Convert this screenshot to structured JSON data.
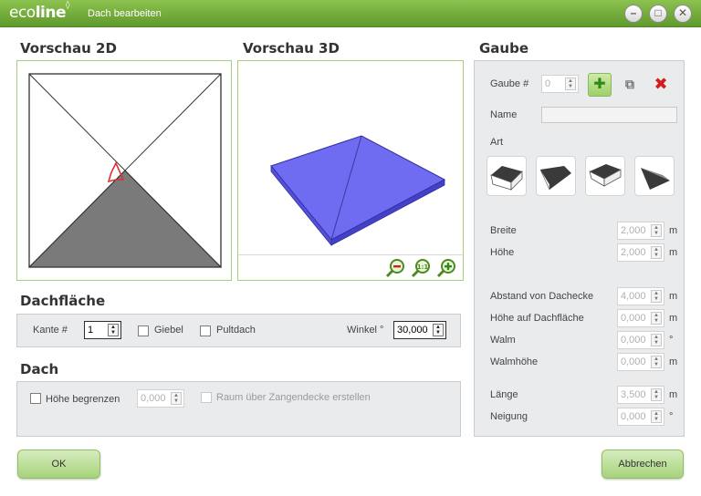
{
  "window": {
    "logo_text": "eco",
    "logo_bold": "line",
    "title": "Dach bearbeiten",
    "buttons": [
      "–",
      "□",
      "✕"
    ]
  },
  "preview2d": {
    "title": "Vorschau 2D"
  },
  "preview3d": {
    "title": "Vorschau 3D",
    "zoom_icons": [
      "zoom-out-icon",
      "zoom-reset-icon",
      "zoom-in-icon"
    ]
  },
  "dachflaeche": {
    "title": "Dachfläche",
    "kante_label": "Kante #",
    "kante_value": "1",
    "giebel_label": "Giebel",
    "pultdach_label": "Pultdach",
    "winkel_label": "Winkel °",
    "winkel_value": "30,000"
  },
  "dach": {
    "title": "Dach",
    "hoehe_begrenzen_label": "Höhe begrenzen",
    "hoehe_value": "0,000",
    "raum_label": "Raum über Zangendecke erstellen"
  },
  "gaube": {
    "title": "Gaube",
    "gaube_num_label": "Gaube #",
    "gaube_num_value": "0",
    "name_label": "Name",
    "name_value": "",
    "art_label": "Art",
    "fields": [
      {
        "label": "Breite",
        "value": "2,000",
        "unit": "m"
      },
      {
        "label": "Höhe",
        "value": "2,000",
        "unit": "m"
      },
      {
        "label": "Abstand von Dachecke",
        "value": "4,000",
        "unit": "m"
      },
      {
        "label": "Höhe auf Dachfläche",
        "value": "0,000",
        "unit": "m"
      },
      {
        "label": "Walm",
        "value": "0,000",
        "unit": "°"
      },
      {
        "label": "Walmhöhe",
        "value": "0,000",
        "unit": "m"
      },
      {
        "label": "Länge",
        "value": "3,500",
        "unit": "m"
      },
      {
        "label": "Neigung",
        "value": "0,000",
        "unit": "°"
      }
    ]
  },
  "footer": {
    "ok_label": "OK",
    "cancel_label": "Abbrechen"
  },
  "colors": {
    "accent": "#7bb241",
    "roof3d": "#6f6cf2",
    "roof2d_fill": "#7a7a7a"
  }
}
